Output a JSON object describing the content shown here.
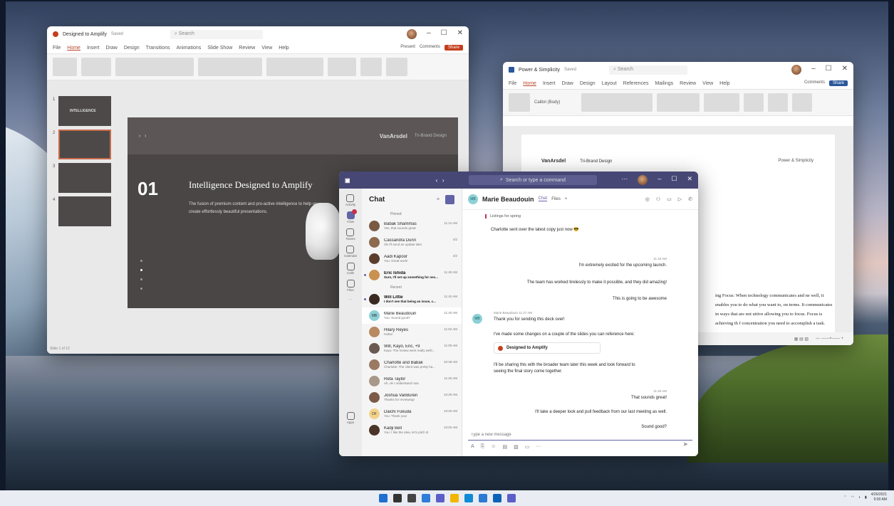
{
  "colors": {
    "ppt_accent": "#c43e1c",
    "word_accent": "#2b579a",
    "teams_accent": "#6264a7",
    "teams_titlebar": "#464775"
  },
  "powerpoint": {
    "title": "Designed to Amplify",
    "saved": "Saved",
    "search_placeholder": "Search",
    "tabs": [
      "File",
      "Home",
      "Insert",
      "Draw",
      "Design",
      "Transitions",
      "Animations",
      "Slide Show",
      "Review",
      "View",
      "Help"
    ],
    "active_tab": "Home",
    "present_label": "Present",
    "comments_label": "Comments",
    "share_label": "Share",
    "thumbnails": [
      {
        "num": "1",
        "label": "INTELLIGENCE"
      },
      {
        "num": "2",
        "label": ""
      },
      {
        "num": "3",
        "label": ""
      },
      {
        "num": "4",
        "label": ""
      }
    ],
    "slide": {
      "number": "01",
      "title": "Intelligence Designed to Amplify",
      "subtitle": "The fusion of premium content and pro-active intelligence to help us create effortlessly beautiful presentations.",
      "brand": "VanArsdel",
      "brand_sub": "Tri-Brand Design"
    },
    "status": "Slide 1 of 12"
  },
  "word": {
    "title": "Power & Simplicity",
    "saved": "Saved",
    "search_placeholder": "Search",
    "tabs": [
      "File",
      "Home",
      "Insert",
      "Draw",
      "Design",
      "Layout",
      "References",
      "Mailings",
      "Review",
      "View",
      "Help"
    ],
    "active_tab": "Home",
    "comments_label": "Comments",
    "share_label": "Share",
    "font_name": "Calibri (Body)",
    "page_brand": "VanArsdel",
    "page_brand_sub": "Tri-Brand Design",
    "page_header_right": "Power & Simplicity",
    "body_text": "ing Focus: When technology communicates and ne well, it enables you to do what you want to, on terms. It communicates in ways that are not uitive allowing you to focus. Focus is achieving th f concentration you need to accomplish a task."
  },
  "teams": {
    "search_placeholder": "Search or type a command",
    "rail": [
      {
        "label": "Activity",
        "icon": "bell-icon"
      },
      {
        "label": "Chat",
        "icon": "chat-icon",
        "active": true,
        "badge": true
      },
      {
        "label": "Teams",
        "icon": "teams-icon"
      },
      {
        "label": "Calendar",
        "icon": "calendar-icon"
      },
      {
        "label": "Calls",
        "icon": "phone-icon"
      },
      {
        "label": "Files",
        "icon": "file-icon"
      }
    ],
    "rail_more": "...",
    "rail_apps": "Apps",
    "list_title": "Chat",
    "pinned_label": "Pinned",
    "recent_label": "Recent",
    "pinned": [
      {
        "name": "Babak Shammas",
        "preview": "Yes, that sounds great",
        "time": "11:12 AM",
        "color": "#7a5a44"
      },
      {
        "name": "Cassandra Dunn",
        "preview": "Ok I'll send an update later",
        "time": "4/2",
        "color": "#8b6a50"
      },
      {
        "name": "Aadi Kapoor",
        "preview": "You: Great work!",
        "time": "4/2",
        "color": "#5b3d2e"
      },
      {
        "name": "Eric Ishida",
        "preview": "Sure, I'll set up something for nex...",
        "time": "11:40 AM",
        "color": "#c9914f",
        "unread": true
      }
    ],
    "recent": [
      {
        "name": "Will Little",
        "preview": "I don't see that being an issue, c...",
        "time": "11:42 AM",
        "color": "#3a2a22",
        "unread": true
      },
      {
        "name": "Marie Beaudouin",
        "preview": "You: Sound good?",
        "time": "11:40 AM",
        "color": "#8dd0d6",
        "initials": "MB",
        "selected": true
      },
      {
        "name": "Hilary Reyes",
        "preview": "Haha!",
        "time": "11:02 AM",
        "color": "#b88a62"
      },
      {
        "name": "Will, Kayo, Eric, +9",
        "preview": "Kayo: The review went really well!...",
        "time": "11:00 AM",
        "color": "#6a5a52"
      },
      {
        "name": "Charlotte and Babak",
        "preview": "Charlotte: The client was pretty ha...",
        "time": "10:48 AM",
        "color": "#9a7a62"
      },
      {
        "name": "Reta Taylor",
        "preview": "Ah, ok I understand now.",
        "time": "11:40 AM",
        "color": "#a89888"
      },
      {
        "name": "Joshua VanBuren",
        "preview": "Thanks for reviewing!",
        "time": "10:29 AM",
        "color": "#7b5b48"
      },
      {
        "name": "Daichi Fukuda",
        "preview": "You: Thank you!",
        "time": "10:20 AM",
        "color": "#f2d38a",
        "initials": "DF"
      },
      {
        "name": "Kadji Bell",
        "preview": "You: I like the idea, let's pitch it!",
        "time": "10:02 AM",
        "color": "#4a3528"
      }
    ],
    "conversation": {
      "name": "Marie Beaudouin",
      "initials": "MB",
      "tab_chat": "Chat",
      "tab_files": "Files",
      "quote": "Listings for spring",
      "msg_charlotte": "Charlotte sent over the latest copy just now 😎",
      "me_time": "11:16 AM",
      "me_1": "I'm extremely excited for the upcoming launch.",
      "me_2": "The team has worked tirelessly to make it possible, and they did amazing!",
      "me_3": "This is going to be awesome",
      "marie_meta": "Marie Beaudouin   11:27 AM",
      "marie_1": "Thank you for sending this deck over!",
      "marie_2": "I've made some changes on a couple of the slides you can reference here:",
      "file_name": "Designed to Amplify",
      "marie_3": "I'll be sharing this with the broader team later this week and look forward to seeing the final story come together.",
      "me2_time": "11:40 AM",
      "me_4": "That sounds great!",
      "me_5": "I'll take a deeper look and pull feedback from our last meeting as well.",
      "me_6": "Sound good?",
      "composer_placeholder": "Type a new message"
    }
  },
  "taskbar": {
    "icons": [
      "start-icon",
      "search-icon",
      "task-view-icon",
      "widgets-icon",
      "chat-icon",
      "file-explorer-icon",
      "edge-icon",
      "store-icon",
      "outlook-icon",
      "teams-icon"
    ],
    "clock_date": "4/26/2021",
    "clock_time": "9:00 AM"
  }
}
